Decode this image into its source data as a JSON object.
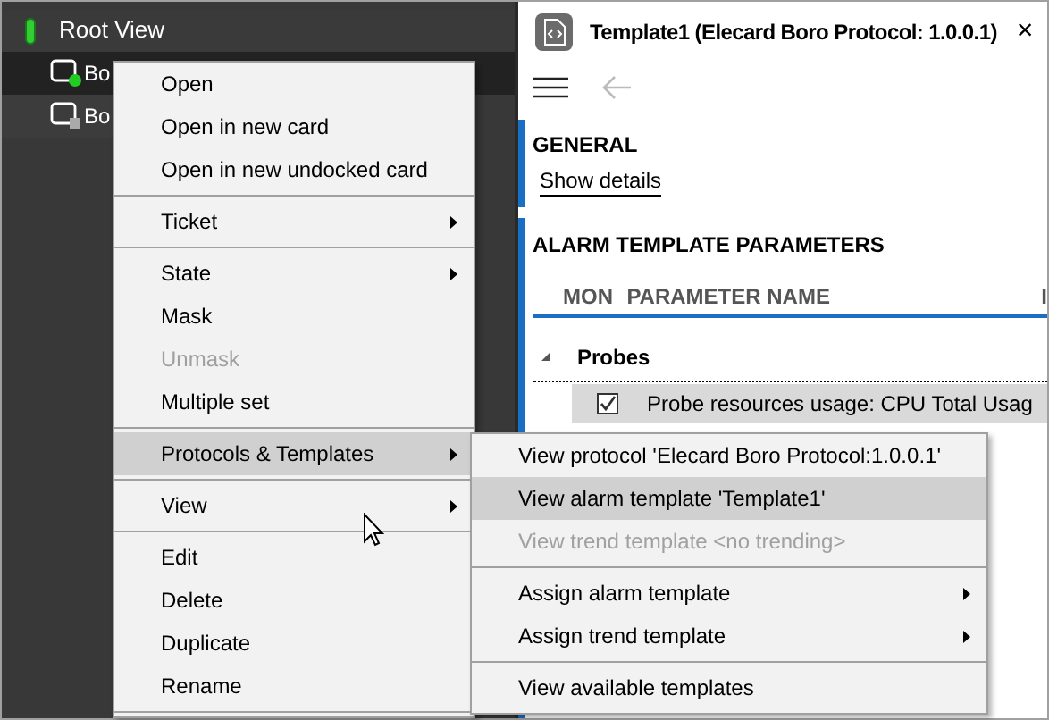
{
  "tree": {
    "root": {
      "label": "Root View",
      "color": "#33cc33"
    },
    "items": [
      {
        "label": "Bo",
        "selected": true,
        "color": "#22cc22"
      },
      {
        "label": "Bo",
        "selected": false,
        "color": "#aaaaaa"
      }
    ]
  },
  "card": {
    "title": "Template1 (Elecard Boro Protocol: 1.0.0.1)",
    "close": "×",
    "sections": [
      {
        "title": "GENERAL",
        "link": "Show details"
      },
      {
        "title": "ALARM TEMPLATE PARAMETERS"
      }
    ],
    "table": {
      "columns": [
        "MON",
        "PARAMETER NAME",
        "I"
      ],
      "groups": [
        {
          "label": "Probes",
          "expanded": true,
          "rows": [
            {
              "name": "Probe resources usage: CPU Total Usag",
              "checked": true,
              "selected": true
            }
          ]
        }
      ]
    }
  },
  "context_menu": [
    {
      "kind": "item",
      "label": "Open",
      "disabled": false,
      "selected": false,
      "submenu": false
    },
    {
      "kind": "item",
      "label": "Open in new card",
      "disabled": false,
      "selected": false,
      "submenu": false
    },
    {
      "kind": "item",
      "label": "Open in new undocked card",
      "disabled": false,
      "selected": false,
      "submenu": false
    },
    {
      "kind": "separator"
    },
    {
      "kind": "item",
      "label": "Ticket",
      "disabled": false,
      "selected": false,
      "submenu": true
    },
    {
      "kind": "separator"
    },
    {
      "kind": "item",
      "label": "State",
      "disabled": false,
      "selected": false,
      "submenu": true
    },
    {
      "kind": "item",
      "label": "Mask",
      "disabled": false,
      "selected": false,
      "submenu": false
    },
    {
      "kind": "item",
      "label": "Unmask",
      "disabled": true,
      "selected": false,
      "submenu": false
    },
    {
      "kind": "item",
      "label": "Multiple set",
      "disabled": false,
      "selected": false,
      "submenu": false
    },
    {
      "kind": "separator"
    },
    {
      "kind": "item",
      "label": "Protocols & Templates",
      "disabled": false,
      "selected": true,
      "submenu": true
    },
    {
      "kind": "separator"
    },
    {
      "kind": "item",
      "label": "View",
      "disabled": false,
      "selected": false,
      "submenu": true
    },
    {
      "kind": "separator"
    },
    {
      "kind": "item",
      "label": "Edit",
      "disabled": false,
      "selected": false,
      "submenu": false
    },
    {
      "kind": "item",
      "label": "Delete",
      "disabled": false,
      "selected": false,
      "submenu": false
    },
    {
      "kind": "item",
      "label": "Duplicate",
      "disabled": false,
      "selected": false,
      "submenu": false
    },
    {
      "kind": "item",
      "label": "Rename",
      "disabled": false,
      "selected": false,
      "submenu": false
    },
    {
      "kind": "separator"
    }
  ],
  "submenu": [
    {
      "kind": "item",
      "label": "View protocol 'Elecard Boro Protocol:1.0.0.1'",
      "disabled": false,
      "selected": false,
      "submenu": false
    },
    {
      "kind": "item",
      "label": "View alarm template 'Template1'",
      "disabled": false,
      "selected": true,
      "submenu": false
    },
    {
      "kind": "item",
      "label": "View trend template <no trending>",
      "disabled": true,
      "selected": false,
      "submenu": false
    },
    {
      "kind": "separator"
    },
    {
      "kind": "item",
      "label": "Assign alarm template",
      "disabled": false,
      "selected": false,
      "submenu": true
    },
    {
      "kind": "item",
      "label": "Assign trend template",
      "disabled": false,
      "selected": false,
      "submenu": true
    },
    {
      "kind": "separator"
    },
    {
      "kind": "item",
      "label": "View available templates",
      "disabled": false,
      "selected": false,
      "submenu": false
    }
  ]
}
